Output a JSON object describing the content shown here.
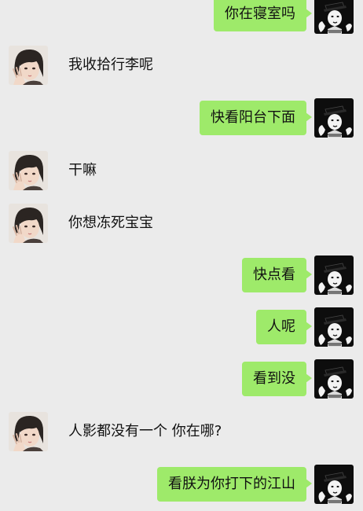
{
  "conversation": {
    "messages": [
      {
        "side": "out",
        "text": "你在寝室吗"
      },
      {
        "side": "in",
        "text": "我收拾行李呢"
      },
      {
        "side": "out",
        "text": "快看阳台下面"
      },
      {
        "side": "in",
        "text": "干嘛"
      },
      {
        "side": "in",
        "text": "你想冻死宝宝"
      },
      {
        "side": "out",
        "text": "快点看"
      },
      {
        "side": "out",
        "text": "人呢"
      },
      {
        "side": "out",
        "text": "看到没"
      },
      {
        "side": "in",
        "text": "人影都没有一个 你在哪?"
      },
      {
        "side": "out",
        "text": "看朕为你打下的江山"
      }
    ]
  },
  "colors": {
    "background": "#ebebeb",
    "outgoing_bubble": "#9eea6a",
    "text": "#111111"
  },
  "icons": {
    "incoming_avatar": "avatar-girl-icon",
    "outgoing_avatar": "avatar-mime-icon"
  }
}
